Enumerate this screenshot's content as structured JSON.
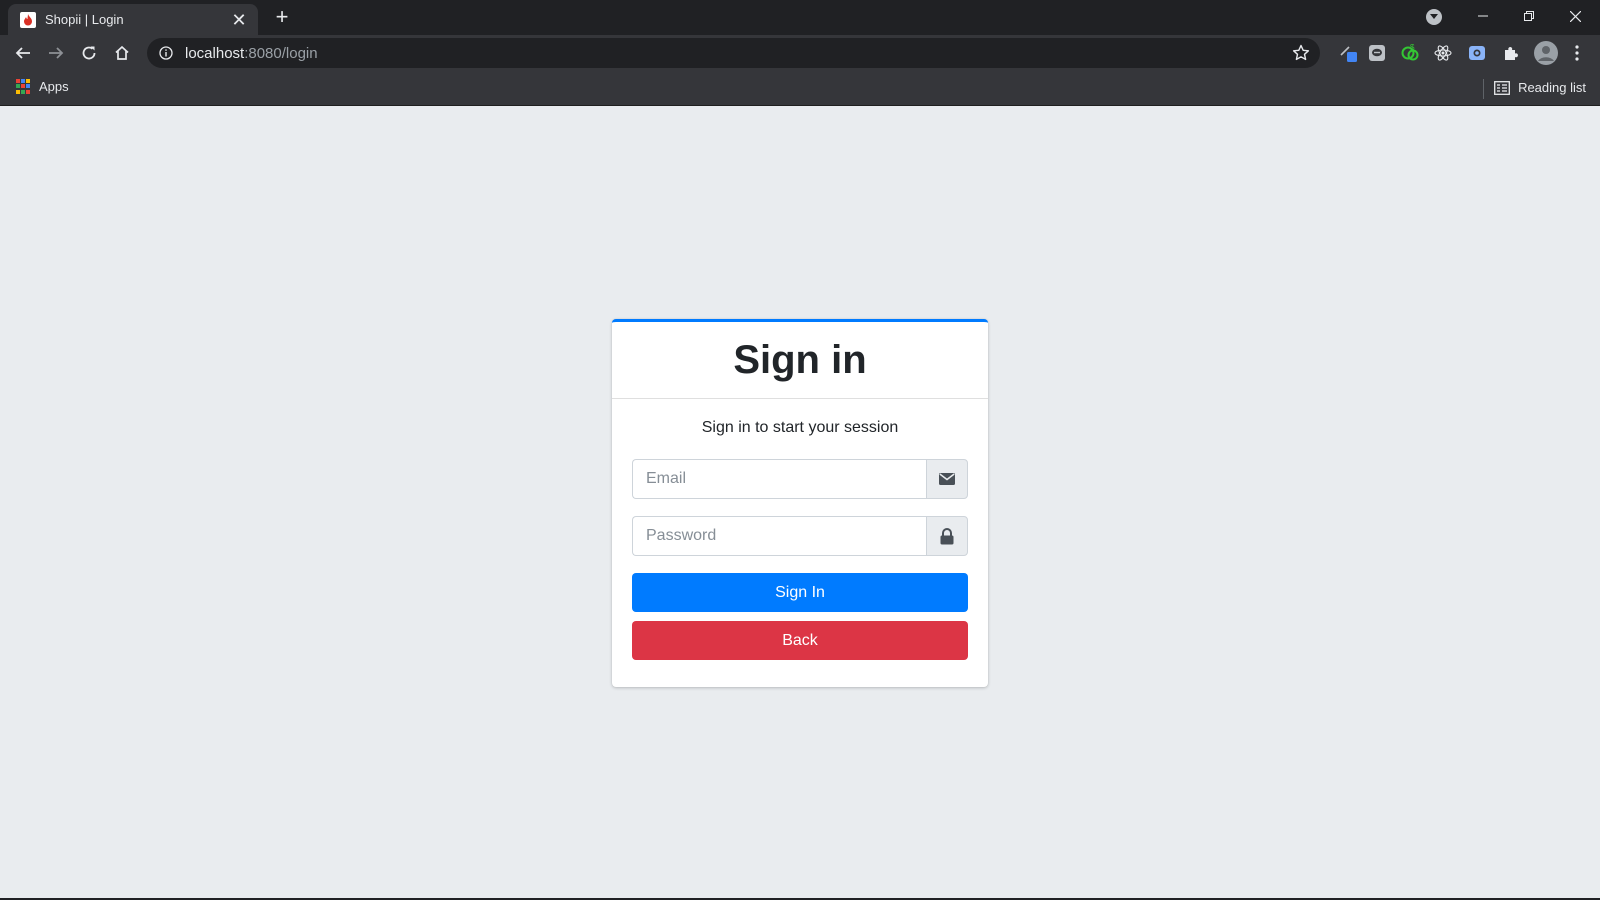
{
  "browser": {
    "tab": {
      "title": "Shopii | Login",
      "close": "✕"
    },
    "new_tab": "+",
    "address": {
      "host": "localhost",
      "path": ":8080/login"
    },
    "bookmarks": {
      "apps_label": "Apps",
      "reading_list_label": "Reading list"
    },
    "colors": {
      "tabstrip": "#202124",
      "toolbar": "#35363a",
      "text": "#e8eaed"
    }
  },
  "login": {
    "title": "Sign in",
    "message": "Sign in to start your session",
    "email_placeholder": "Email",
    "password_placeholder": "Password",
    "sign_in_label": "Sign In",
    "back_label": "Back",
    "colors": {
      "accent": "#007bff",
      "danger": "#dc3545",
      "background": "#e9ecef"
    },
    "icons": {
      "email": "envelope-icon",
      "password": "lock-icon"
    }
  }
}
